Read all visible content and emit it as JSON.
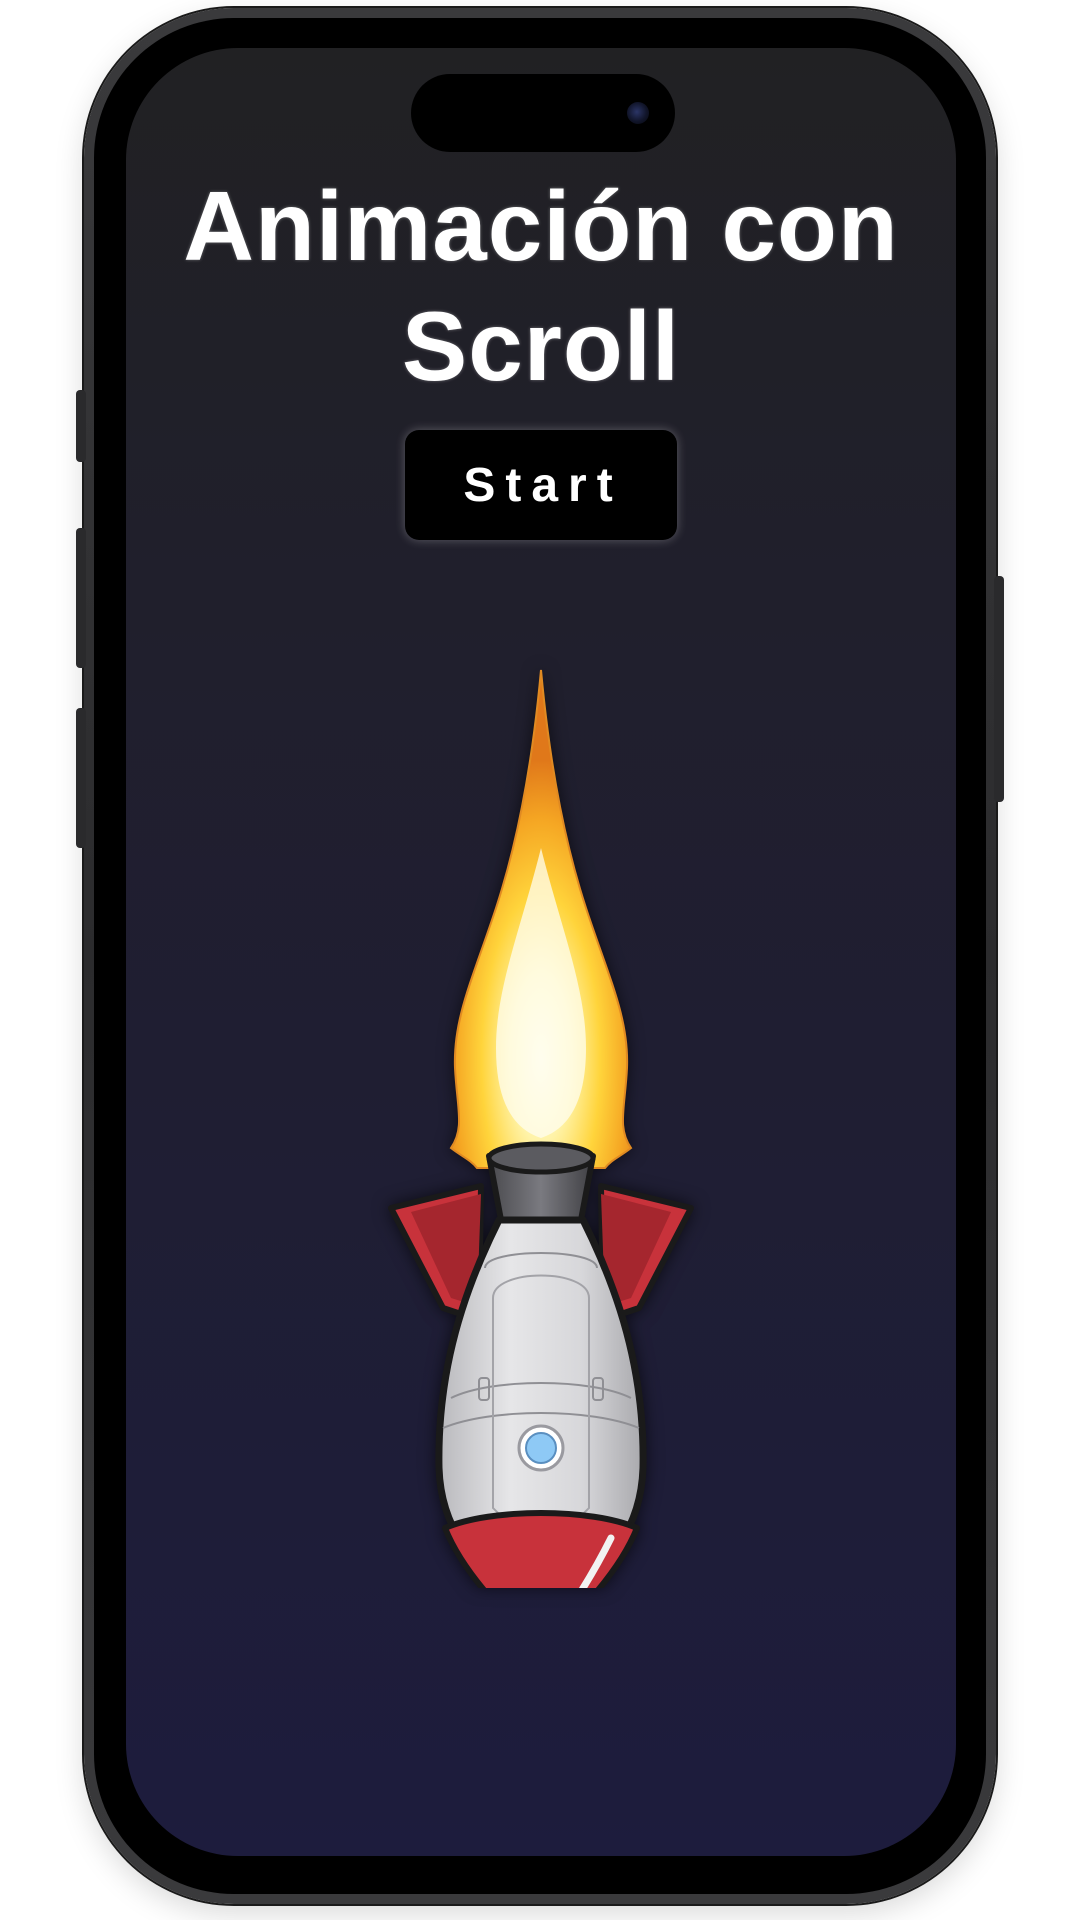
{
  "page": {
    "title": "Animación con Scroll",
    "start_label": "Start"
  },
  "icons": {
    "rocket": "rocket-icon",
    "flame": "flame-icon"
  },
  "colors": {
    "background_top": "#212123",
    "background_bottom": "#1d1c3d",
    "button_bg": "#000000",
    "text": "#ffffff",
    "rocket_red": "#c8323b",
    "rocket_body": "#d9d9dc",
    "flame_yellow": "#ffd43b",
    "flame_orange": "#f08a1c"
  }
}
